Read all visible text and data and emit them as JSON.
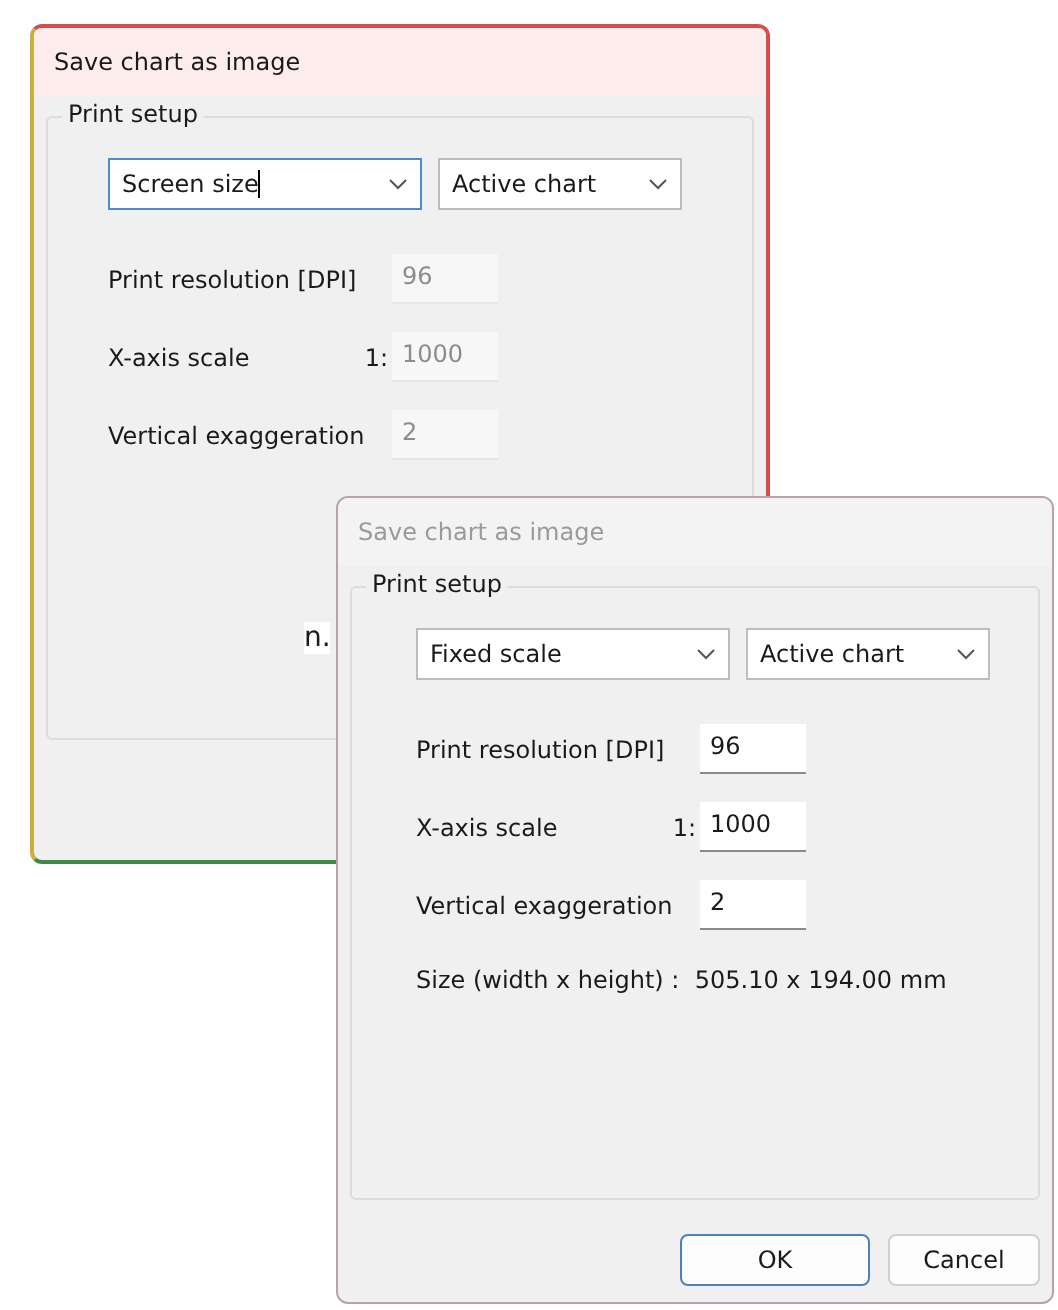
{
  "background_text": "n.",
  "dialogs": [
    {
      "title": "Save chart as image",
      "active": true,
      "group_title": "Print setup",
      "fields_disabled": true,
      "combos": [
        {
          "value": "Screen size",
          "focused": true
        },
        {
          "value": "Active chart",
          "focused": false
        }
      ],
      "fields": [
        {
          "label": "Print resolution [DPI]",
          "value": "96"
        },
        {
          "label": "X-axis scale",
          "prefix": "1:",
          "value": "1000"
        },
        {
          "label": "Vertical exaggeration",
          "value": "2"
        }
      ]
    },
    {
      "title": "Save chart as image",
      "active": false,
      "group_title": "Print setup",
      "fields_disabled": false,
      "combos": [
        {
          "value": "Fixed scale",
          "focused": false
        },
        {
          "value": "Active chart",
          "focused": false
        }
      ],
      "fields": [
        {
          "label": "Print resolution [DPI]",
          "value": "96"
        },
        {
          "label": "X-axis scale",
          "prefix": "1:",
          "value": "1000"
        },
        {
          "label": "Vertical exaggeration",
          "value": "2"
        }
      ],
      "size_text": "Size (width x height) :  505.10 x 194.00 mm",
      "buttons": [
        {
          "label": "OK",
          "default": true
        },
        {
          "label": "Cancel",
          "default": false
        }
      ]
    }
  ]
}
